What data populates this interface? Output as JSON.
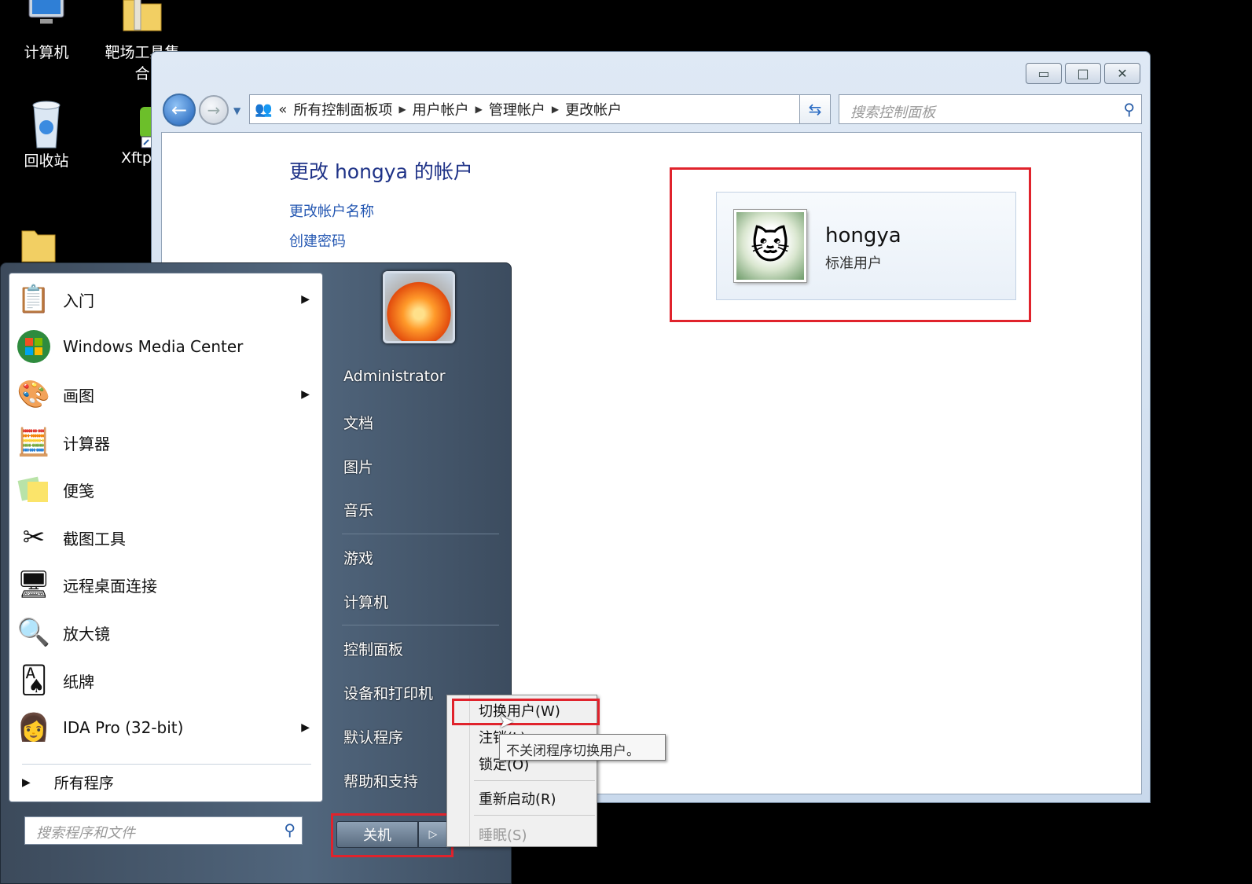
{
  "desktop": {
    "icons": [
      {
        "label": "计算机",
        "icon": "computer-icon"
      },
      {
        "label": "靶场工具集合",
        "icon": "folder-icon"
      },
      {
        "label": "回收站",
        "icon": "recycle-bin-icon"
      },
      {
        "label": "Xftp",
        "icon": "xftp-icon"
      }
    ]
  },
  "control_panel": {
    "address": {
      "overflow": "«",
      "crumbs": [
        "所有控制面板项",
        "用户帐户",
        "管理帐户",
        "更改帐户"
      ]
    },
    "search_placeholder": "搜索控制面板",
    "heading": "更改 hongya 的帐户",
    "links": [
      "更改帐户名称",
      "创建密码"
    ],
    "account": {
      "name": "hongya",
      "type": "标准用户"
    }
  },
  "start_menu": {
    "programs": [
      {
        "label": "入门",
        "icon": "getting-started-icon",
        "has_arrow": true
      },
      {
        "label": "Windows Media Center",
        "icon": "media-center-icon",
        "has_arrow": false
      },
      {
        "label": "画图",
        "icon": "paint-icon",
        "has_arrow": true
      },
      {
        "label": "计算器",
        "icon": "calculator-icon",
        "has_arrow": false
      },
      {
        "label": "便笺",
        "icon": "sticky-notes-icon",
        "has_arrow": false
      },
      {
        "label": "截图工具",
        "icon": "snipping-tool-icon",
        "has_arrow": false
      },
      {
        "label": "远程桌面连接",
        "icon": "remote-desktop-icon",
        "has_arrow": false
      },
      {
        "label": "放大镜",
        "icon": "magnifier-icon",
        "has_arrow": false
      },
      {
        "label": "纸牌",
        "icon": "solitaire-icon",
        "has_arrow": false
      },
      {
        "label": "IDA Pro (32-bit)",
        "icon": "ida-pro-icon",
        "has_arrow": true
      }
    ],
    "all_programs": "所有程序",
    "search_placeholder": "搜索程序和文件",
    "right_items": [
      "Administrator",
      "文档",
      "图片",
      "音乐",
      "游戏",
      "计算机",
      "控制面板",
      "设备和打印机",
      "默认程序",
      "帮助和支持"
    ],
    "shutdown_label": "关机"
  },
  "shutdown_menu": {
    "items": [
      "切换用户(W)",
      "注销(L)",
      "锁定(O)",
      "重新启动(R)",
      "睡眠(S)"
    ],
    "tooltip": "不关闭程序切换用户。"
  },
  "colors": {
    "highlight": "#e0232c",
    "link": "#2457b2",
    "heading": "#1e3287"
  }
}
